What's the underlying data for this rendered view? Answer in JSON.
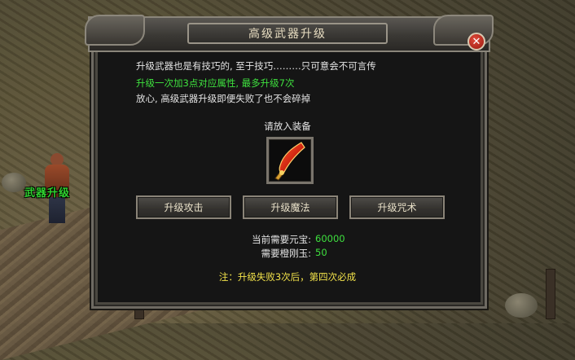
{
  "dialog": {
    "title": "高级武器升级",
    "close_symbol": "✕",
    "lines": [
      "升级武器也是有技巧的, 至于技巧………只可意会不可言传",
      "升级一次加3点对应属性, 最多升级7次",
      "放心, 高级武器升级即便失败了也不会碎掉"
    ],
    "prompt": "请放入装备",
    "equipment_icon": "red-blade-weapon-icon",
    "buttons": [
      "升级攻击",
      "升级魔法",
      "升级咒术"
    ],
    "requirements": [
      {
        "label": "当前需要元宝:",
        "value": "60000"
      },
      {
        "label": "需要橙刚玉:",
        "value": "50"
      }
    ],
    "note": "注：升级失败3次后，第四次必成"
  },
  "scene": {
    "npc_label": "武器升级"
  },
  "colors": {
    "accent_green": "#3ee03e",
    "note_yellow": "#f2e24a",
    "dialog_bg": "#151515"
  }
}
